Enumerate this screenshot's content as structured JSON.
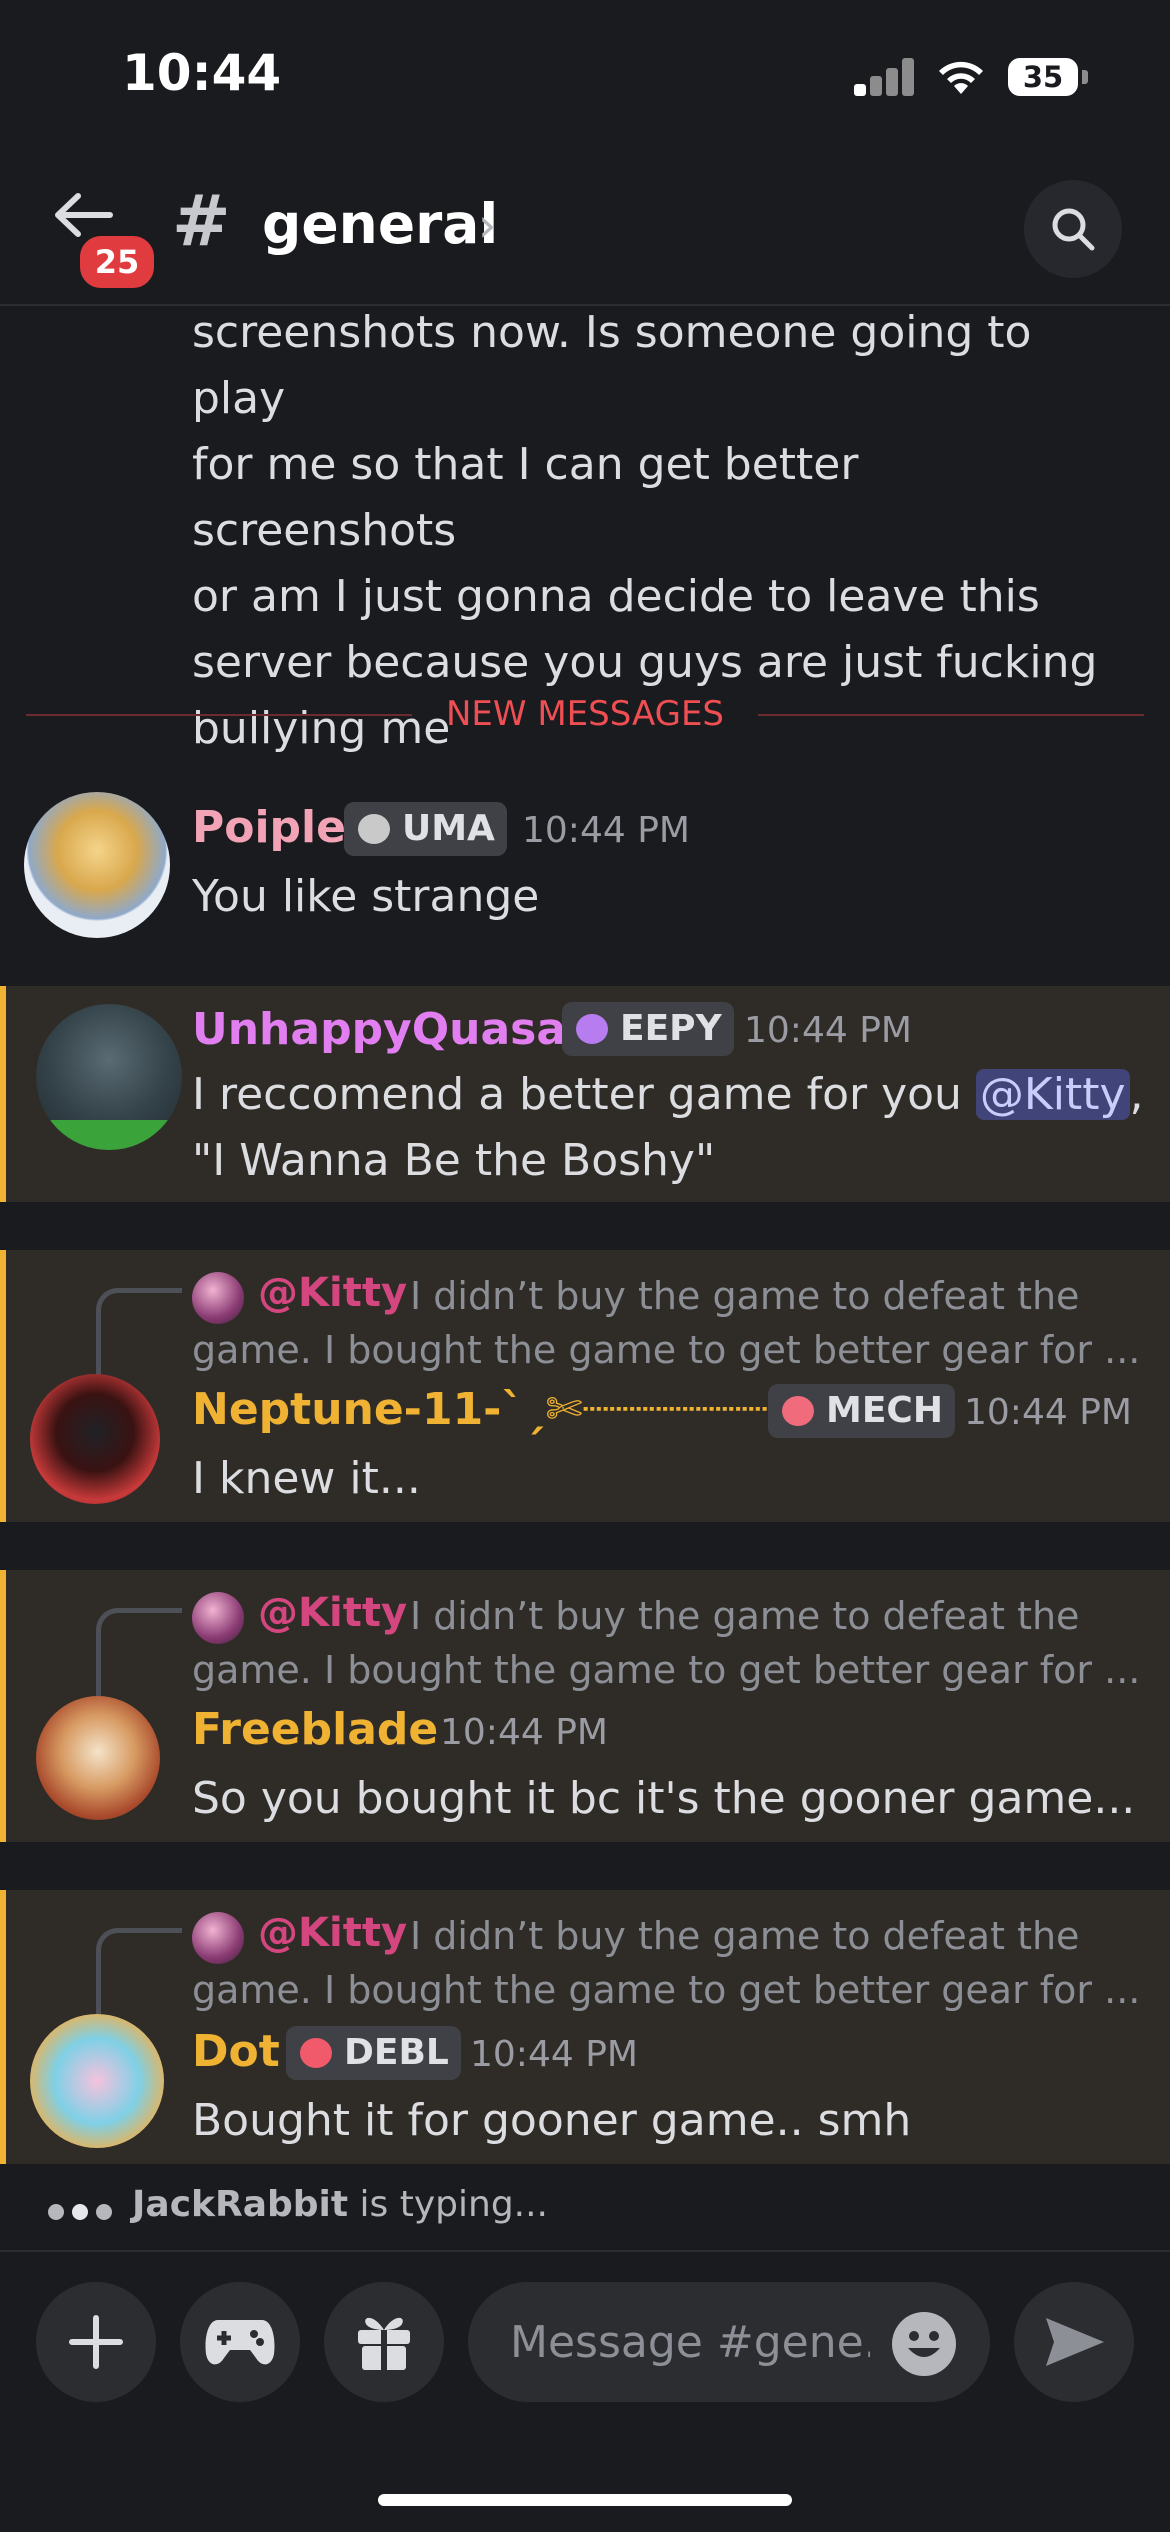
{
  "status": {
    "time": "10:44",
    "battery": "35"
  },
  "header": {
    "unread_badge": "25",
    "hash": "#",
    "channel": "general",
    "chevron": "›"
  },
  "messages": {
    "prev_continuation": [
      "screenshots now. Is someone going to play",
      "for me so that I can get better screenshots",
      "or am I just gonna decide to leave this",
      "server because you guys are just fucking",
      "bullying me"
    ],
    "divider": "NEW MESSAGES",
    "poiple": {
      "name": "Poiple",
      "tag": "UMA",
      "time": "10:44 PM",
      "text": "You like strange"
    },
    "quasar": {
      "name": "UnhappyQuasar",
      "tag": "EEPY",
      "time": "10:44 PM",
      "line1_pre": "I reccomend a better game for you ",
      "mention": "@Kitty",
      "line1_post": ",",
      "line2": "\"I Wanna Be the Boshy\""
    },
    "reply_ref": {
      "mention": "@Kitty",
      "line1": "I didn’t buy the game to defeat the",
      "line2": "game. I bought the game to get better gear for ..."
    },
    "neptune": {
      "name": "Neptune-11-`ˏ✄┈┈┈┈┈┈┈┈┈┈",
      "tag": "MECH",
      "time": "10:44 PM",
      "text": "I knew it..."
    },
    "freeblade": {
      "name": "Freeblade",
      "time": "10:44 PM",
      "text": "So you bought it bc it's the gooner game..."
    },
    "dot": {
      "name": "Dot",
      "tag": "DEBL",
      "time": "10:44 PM",
      "text": "Bought it for gooner game.. smh"
    }
  },
  "typing": {
    "user": "JackRabbit",
    "suffix": " is typing..."
  },
  "composer": {
    "placeholder": "Message #gene..."
  },
  "colors": {
    "accent_mention": "#d4467f",
    "highlight_bar": "#f0b232",
    "new_messages": "#ef4e52"
  }
}
